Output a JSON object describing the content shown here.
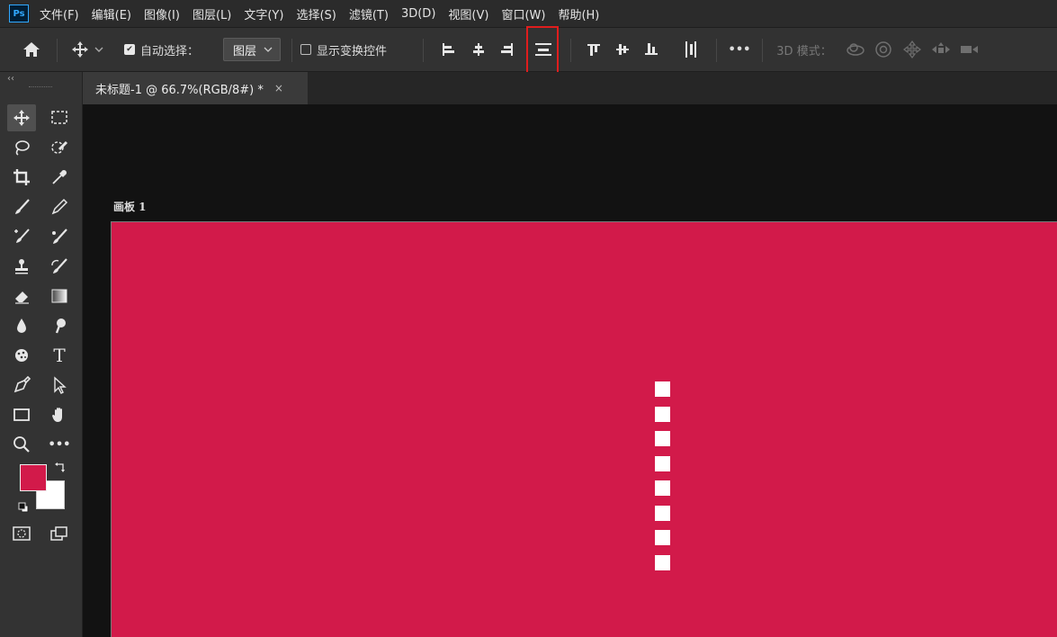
{
  "app": {
    "logo": "Ps"
  },
  "menubar": {
    "items": [
      "文件(F)",
      "编辑(E)",
      "图像(I)",
      "图层(L)",
      "文字(Y)",
      "选择(S)",
      "滤镜(T)",
      "3D(D)",
      "视图(V)",
      "窗口(W)",
      "帮助(H)"
    ]
  },
  "options_bar": {
    "auto_select_label": "自动选择：",
    "auto_select_checked": true,
    "auto_select_target": "图层",
    "show_transform_label": "显示变换控件",
    "show_transform_checked": false,
    "more_label": "•••",
    "mode_3d_label": "3D 模式："
  },
  "document_tab": {
    "title": "未标题-1 @ 66.7%(RGB/8#) *",
    "close": "×"
  },
  "toolbar": {
    "collapse": "‹‹",
    "text_tool_glyph": "T",
    "more_glyph": "•••"
  },
  "colors": {
    "foreground": "#d21a4a",
    "background": "#ffffff",
    "artboard_fill": "#d21a4a",
    "highlight_box": "#e01d1d"
  },
  "canvas": {
    "artboard_name": "画板 1",
    "square_count": 8
  }
}
